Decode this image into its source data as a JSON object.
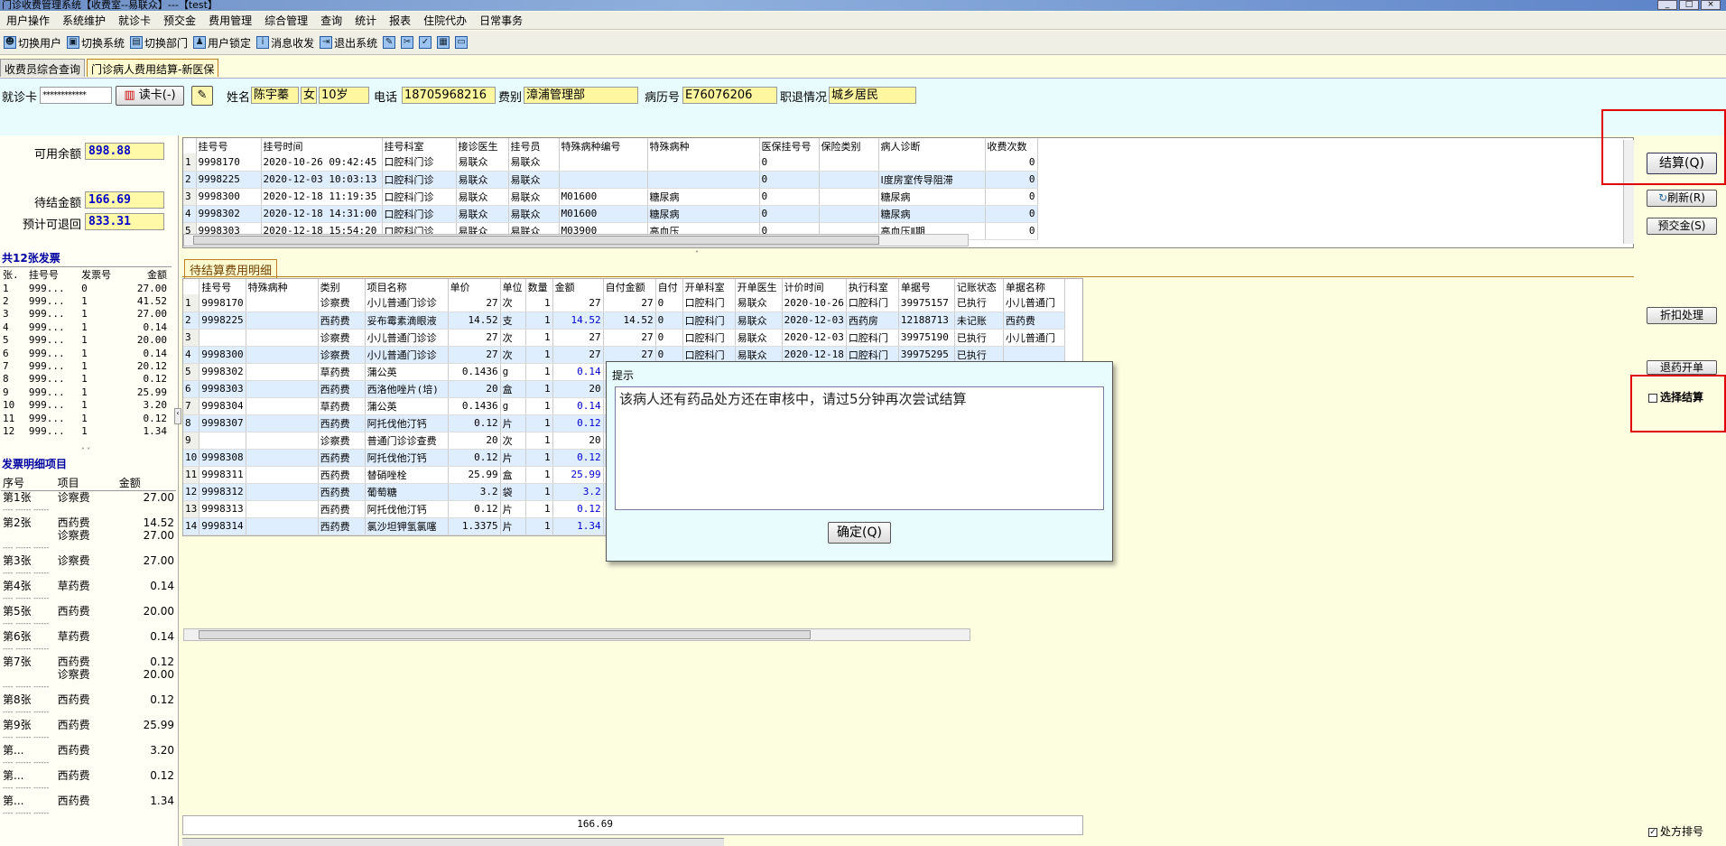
{
  "window": {
    "title": "门诊收费管理系统【收费室--易联众】---【test】"
  },
  "menu": [
    "用户操作",
    "系统维护",
    "就诊卡",
    "预交金",
    "费用管理",
    "综合管理",
    "查询",
    "统计",
    "报表",
    "住院代办",
    "日常事务"
  ],
  "toolbar": {
    "switch_user": "切换用户",
    "switch_system": "切换系统",
    "switch_dept": "切换部门",
    "lock_user": "用户锁定",
    "messages": "消息收发",
    "exit": "退出系统"
  },
  "tabs": [
    "收费员综合查询",
    "门诊病人费用结算-新医保"
  ],
  "patient": {
    "card_label": "就诊卡",
    "card_value": "************",
    "read_card": "读卡(-)",
    "name_label": "姓名",
    "name": "陈宇蓁",
    "sex": "女",
    "age": "10岁",
    "phone_label": "电话",
    "phone": "18705968216",
    "fee_type_label": "费别",
    "fee_type": "漳浦管理部",
    "record_label": "病历号",
    "record_no": "E76076206",
    "job_label": "职退情况",
    "job_status": "城乡居民"
  },
  "summary": {
    "available_label": "可用余额",
    "available": "898.88",
    "pending_label": "待结金额",
    "pending": "166.69",
    "refund_label": "预计可退回",
    "refund": "833.31"
  },
  "invoices": {
    "heading": "共12张发票",
    "headers": [
      "张.",
      "挂号号",
      "发票号",
      "金额"
    ],
    "rows": [
      [
        "1",
        "999...",
        "0",
        "27.00"
      ],
      [
        "2",
        "999...",
        "1",
        "41.52"
      ],
      [
        "3",
        "999...",
        "1",
        "27.00"
      ],
      [
        "4",
        "999...",
        "1",
        "0.14"
      ],
      [
        "5",
        "999...",
        "1",
        "20.00"
      ],
      [
        "6",
        "999...",
        "1",
        "0.14"
      ],
      [
        "7",
        "999...",
        "1",
        "20.12"
      ],
      [
        "8",
        "999...",
        "1",
        "0.12"
      ],
      [
        "9",
        "999...",
        "1",
        "25.99"
      ],
      [
        "10",
        "999...",
        "1",
        "3.20"
      ],
      [
        "11",
        "999...",
        "1",
        "0.12"
      ],
      [
        "12",
        "999...",
        "1",
        "1.34"
      ]
    ]
  },
  "invoice_detail": {
    "heading": "发票明细项目",
    "headers": [
      "序号",
      "项目",
      "金额"
    ],
    "groups": [
      {
        "no": "第1张",
        "items": [
          [
            "诊察费",
            "27.00"
          ]
        ]
      },
      {
        "no": "第2张",
        "items": [
          [
            "西药费",
            "14.52"
          ],
          [
            "诊察费",
            "27.00"
          ]
        ]
      },
      {
        "no": "第3张",
        "items": [
          [
            "诊察费",
            "27.00"
          ]
        ]
      },
      {
        "no": "第4张",
        "items": [
          [
            "草药费",
            "0.14"
          ]
        ]
      },
      {
        "no": "第5张",
        "items": [
          [
            "西药费",
            "20.00"
          ]
        ]
      },
      {
        "no": "第6张",
        "items": [
          [
            "草药费",
            "0.14"
          ]
        ]
      },
      {
        "no": "第7张",
        "items": [
          [
            "西药费",
            "0.12"
          ],
          [
            "诊察费",
            "20.00"
          ]
        ]
      },
      {
        "no": "第8张",
        "items": [
          [
            "西药费",
            "0.12"
          ]
        ]
      },
      {
        "no": "第9张",
        "items": [
          [
            "西药费",
            "25.99"
          ]
        ]
      },
      {
        "no": "第...",
        "items": [
          [
            "西药费",
            "3.20"
          ]
        ]
      },
      {
        "no": "第...",
        "items": [
          [
            "西药费",
            "0.12"
          ]
        ]
      },
      {
        "no": "第...",
        "items": [
          [
            "西药费",
            "1.34"
          ]
        ]
      }
    ]
  },
  "registrations": {
    "headers": [
      "挂号号",
      "挂号时间",
      "挂号科室",
      "接诊医生",
      "挂号员",
      "特殊病种编号",
      "特殊病种",
      "医保挂号号",
      "保险类别",
      "病人诊断",
      "收费次数"
    ],
    "rows": [
      [
        "9998170",
        "2020-10-26 09:42:45",
        "口腔科门诊",
        "易联众",
        "易联众",
        "",
        "",
        "0",
        "",
        "",
        "0"
      ],
      [
        "9998225",
        "2020-12-03 10:03:13",
        "口腔科门诊",
        "易联众",
        "易联众",
        "",
        "",
        "0",
        "",
        "Ⅰ度房室传导阻滞",
        "0"
      ],
      [
        "9998300",
        "2020-12-18 11:19:35",
        "口腔科门诊",
        "易联众",
        "易联众",
        "M01600",
        "糖尿病",
        "0",
        "",
        "糖尿病",
        "0"
      ],
      [
        "9998302",
        "2020-12-18 14:31:00",
        "口腔科门诊",
        "易联众",
        "易联众",
        "M01600",
        "糖尿病",
        "0",
        "",
        "糖尿病",
        "0"
      ],
      [
        "9998303",
        "2020-12-18 15:54:20",
        "口腔科门诊",
        "易联众",
        "易联众",
        "M03900",
        "高血压",
        "0",
        "",
        "高血压Ⅱ期",
        "0"
      ]
    ]
  },
  "pending_tab": "待结算费用明细",
  "fees": {
    "headers": [
      "挂号号",
      "特殊病种",
      "类别",
      "项目名称",
      "单价",
      "单位",
      "数量",
      "金额",
      "自付金额",
      "自付",
      "开单科室",
      "开单医生",
      "计价时间",
      "执行科室",
      "单据号",
      "记账状态",
      "单据名称"
    ],
    "rows": [
      [
        "9998170",
        "",
        "诊察费",
        "小儿普通门诊诊",
        "27",
        "次",
        "1",
        "27",
        "27",
        "0",
        "口腔科门",
        "易联众",
        "2020-10-26",
        "口腔科门",
        "39975157",
        "已执行",
        "小儿普通门"
      ],
      [
        "9998225",
        "",
        "西药费",
        "妥布霉素滴眼液",
        "14.52",
        "支",
        "1",
        "14.52",
        "14.52",
        "0",
        "口腔科门",
        "易联众",
        "2020-12-03",
        "西药房",
        "12188713",
        "未记账",
        "西药费"
      ],
      [
        "",
        "",
        "诊察费",
        "小儿普通门诊诊",
        "27",
        "次",
        "1",
        "27",
        "27",
        "0",
        "口腔科门",
        "易联众",
        "2020-12-03",
        "口腔科门",
        "39975190",
        "已执行",
        "小儿普通门"
      ],
      [
        "9998300",
        "",
        "诊察费",
        "小儿普通门诊诊",
        "27",
        "次",
        "1",
        "27",
        "27",
        "0",
        "口腔科门",
        "易联众",
        "2020-12-18",
        "口腔科门",
        "39975295",
        "已执行",
        ""
      ],
      [
        "9998302",
        "",
        "草药费",
        "蒲公英",
        "0.1436",
        "g",
        "1",
        "0.14",
        "",
        "",
        "",
        "",
        "",
        "",
        "",
        "",
        ""
      ],
      [
        "9998303",
        "",
        "西药费",
        "西洛他唑片(培)",
        "20",
        "盒",
        "1",
        "20",
        "",
        "",
        "",
        "",
        "",
        "",
        "",
        "",
        ""
      ],
      [
        "9998304",
        "",
        "草药费",
        "蒲公英",
        "0.1436",
        "g",
        "1",
        "0.14",
        "",
        "",
        "",
        "",
        "",
        "",
        "",
        "",
        ""
      ],
      [
        "9998307",
        "",
        "西药费",
        "阿托伐他汀钙",
        "0.12",
        "片",
        "1",
        "0.12",
        "",
        "",
        "",
        "",
        "",
        "",
        "",
        "",
        ""
      ],
      [
        "",
        "",
        "诊察费",
        "普通门诊诊查费",
        "20",
        "次",
        "1",
        "20",
        "",
        "",
        "",
        "",
        "",
        "",
        "",
        "",
        ""
      ],
      [
        "9998308",
        "",
        "西药费",
        "阿托伐他汀钙",
        "0.12",
        "片",
        "1",
        "0.12",
        "",
        "",
        "",
        "",
        "",
        "",
        "",
        "",
        ""
      ],
      [
        "9998311",
        "",
        "西药费",
        "替硝唑栓",
        "25.99",
        "盒",
        "1",
        "25.99",
        "",
        "",
        "",
        "",
        "",
        "",
        "",
        "",
        ""
      ],
      [
        "9998312",
        "",
        "西药费",
        "葡萄糖",
        "3.2",
        "袋",
        "1",
        "3.2",
        "",
        "",
        "",
        "",
        "",
        "",
        "",
        "",
        ""
      ],
      [
        "9998313",
        "",
        "西药费",
        "阿托伐他汀钙",
        "0.12",
        "片",
        "1",
        "0.12",
        "",
        "",
        "",
        "",
        "",
        "",
        "",
        "",
        ""
      ],
      [
        "9998314",
        "",
        "西药费",
        "氯沙坦钾氢氯噻",
        "1.3375",
        "片",
        "1",
        "1.34",
        "",
        "",
        "",
        "",
        "",
        "",
        "",
        "",
        ""
      ]
    ],
    "total": "166.69"
  },
  "actions": {
    "settle": "结算(Q)",
    "refresh": "刷新(R)",
    "prepay": "预交金(S)",
    "discount": "折扣处理",
    "return_drug": "退药开单",
    "select_settle": "选择结算",
    "rx_order": "处方排号"
  },
  "dialog": {
    "title": "提示",
    "message": "该病人还有药品处方还在审核中，请过5分钟再次尝试结算",
    "ok": "确定(Q)"
  },
  "colors": {
    "highlight_box": "#e00000",
    "value_bg": "#fff7a0",
    "row_alt": "#dfeeff"
  }
}
